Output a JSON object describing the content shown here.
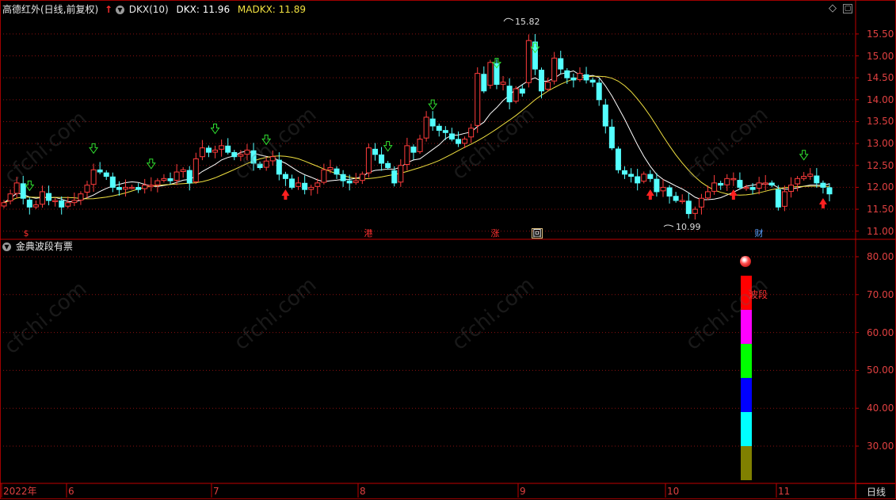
{
  "title_bar": {
    "stock_name": "高德红外(日线,前复权)",
    "indicator_name": "DKX(10)",
    "dkx_label": "DKX: 11.96",
    "madkx_label": "MADKX: 11.89"
  },
  "lower_panel": {
    "indicator_name": "金典波段有票",
    "bar_label": "波段"
  },
  "price_axis": [
    "15.50",
    "15.00",
    "14.50",
    "14.00",
    "13.50",
    "13.00",
    "12.50",
    "12.00",
    "11.50",
    "11.00"
  ],
  "lower_axis": [
    "80.00",
    "70.00",
    "60.00",
    "50.00",
    "40.00",
    "30.00"
  ],
  "time_axis": [
    "2022年",
    "6",
    "7",
    "8",
    "9",
    "10",
    "11"
  ],
  "period_button": "日线",
  "annotations": {
    "high": "15.82",
    "low": "10.99"
  },
  "event_markers": [
    {
      "label": "$",
      "color": "#ff3030"
    },
    {
      "label": "港",
      "color": "#ff3030"
    },
    {
      "label": "涨",
      "color": "#ff3030"
    },
    {
      "label": "回",
      "color": "#ffffff"
    },
    {
      "label": "财",
      "color": "#5aa0ff"
    }
  ],
  "watermark": "cfchi.com",
  "colors": {
    "up": "#ff3c3c",
    "down": "#54ffff",
    "dkx": "#ffffff",
    "madkx": "#f0e040",
    "axis": "#c00000",
    "grid": "#8a1010"
  },
  "band_segments": [
    {
      "from": 21,
      "to": 30,
      "color": "#808000"
    },
    {
      "from": 30,
      "to": 39,
      "color": "#00ffff"
    },
    {
      "from": 39,
      "to": 48,
      "color": "#0000ff"
    },
    {
      "from": 48,
      "to": 57,
      "color": "#00ff00"
    },
    {
      "from": 57,
      "to": 66,
      "color": "#ff00ff"
    },
    {
      "from": 66,
      "to": 75,
      "color": "#ff0000"
    }
  ],
  "chart_data": {
    "type": "candlestick",
    "title": "高德红外(日线,前复权)",
    "ylim": [
      10.85,
      15.95
    ],
    "x_labels": [
      "2022年",
      "6",
      "7",
      "8",
      "9",
      "10",
      "11"
    ],
    "ohlc_close": [
      11.65,
      11.85,
      12.1,
      11.75,
      11.55,
      11.6,
      11.9,
      11.7,
      11.7,
      11.55,
      11.65,
      11.7,
      11.85,
      12.05,
      12.4,
      12.35,
      12.25,
      12.0,
      11.95,
      12.0,
      12.0,
      11.95,
      12.05,
      12.05,
      12.15,
      12.2,
      12.15,
      12.35,
      12.4,
      12.1,
      12.65,
      12.9,
      12.8,
      12.85,
      12.95,
      12.8,
      12.7,
      12.75,
      12.85,
      12.55,
      12.45,
      12.6,
      12.7,
      12.3,
      12.2,
      12.0,
      12.1,
      11.95,
      12.0,
      12.1,
      12.4,
      12.45,
      12.3,
      12.15,
      12.1,
      12.15,
      12.3,
      12.9,
      12.75,
      12.55,
      12.45,
      12.1,
      12.5,
      12.95,
      12.8,
      13.1,
      13.6,
      13.4,
      13.3,
      13.25,
      13.1,
      13.0,
      13.1,
      13.35,
      14.6,
      14.2,
      14.85,
      14.35,
      14.4,
      13.95,
      14.25,
      14.15,
      15.35,
      14.7,
      14.2,
      14.4,
      14.95,
      14.7,
      14.5,
      14.45,
      14.6,
      14.45,
      14.4,
      14.0,
      13.4,
      12.9,
      12.4,
      12.3,
      12.25,
      12.1,
      12.3,
      12.2,
      11.9,
      12.0,
      11.8,
      11.7,
      11.7,
      11.4,
      11.5,
      11.75,
      11.9,
      12.1,
      12.05,
      12.2,
      12.2,
      12.0,
      12.0,
      11.95,
      12.1,
      12.1,
      12.05,
      11.55,
      11.9,
      12.05,
      12.2,
      12.25,
      12.3,
      12.1,
      12.0,
      11.85
    ]
  }
}
